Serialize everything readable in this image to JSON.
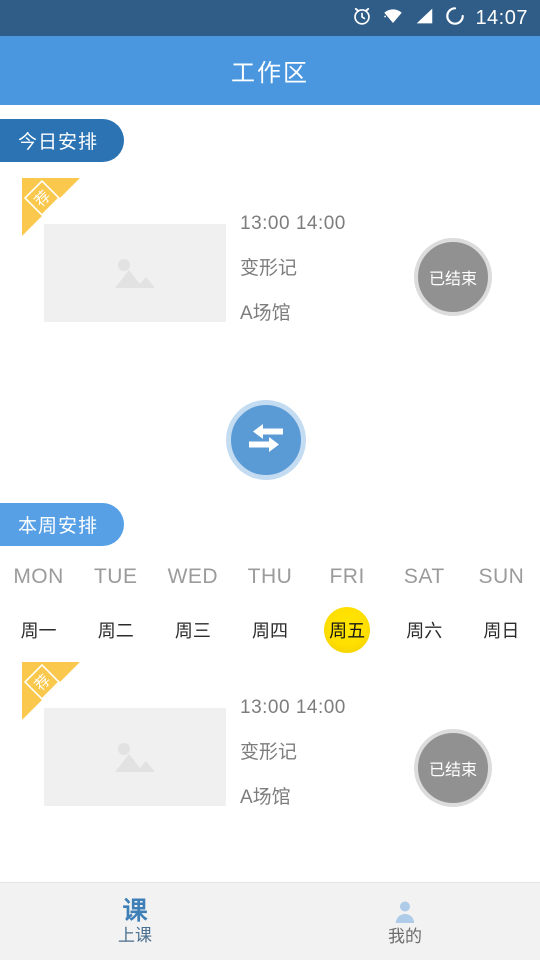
{
  "status_bar": {
    "time": "14:07",
    "icons": [
      "alarm-icon",
      "wifi-icon",
      "signal-icon",
      "sync-icon"
    ]
  },
  "app_bar": {
    "title": "工作区",
    "background": "#4a97e0"
  },
  "sections": {
    "today": {
      "label": "今日安排",
      "pill_color": "#2b73b3"
    },
    "week": {
      "label": "本周安排",
      "pill_color": "#57a0e6"
    }
  },
  "swap_button": {
    "name": "swap-arrows-icon",
    "color": "#5b9bd5"
  },
  "today_event": {
    "ribbon_text": "荐",
    "time": "13:00 14:00",
    "title": "变形记",
    "venue": "A场馆",
    "status": "已结束",
    "status_color": "#919191",
    "thumbnail": "image-placeholder"
  },
  "week_event": {
    "ribbon_text": "荐",
    "time": "13:00 14:00",
    "title": "变形记",
    "venue": "A场馆",
    "status": "已结束",
    "status_color": "#919191",
    "thumbnail": "image-placeholder"
  },
  "week_selector": {
    "selected_index": 4,
    "highlight_color": "#ffdf00",
    "days": [
      {
        "en": "MON",
        "cn": "周一"
      },
      {
        "en": "TUE",
        "cn": "周二"
      },
      {
        "en": "WED",
        "cn": "周三"
      },
      {
        "en": "THU",
        "cn": "周四"
      },
      {
        "en": "FRI",
        "cn": "周五"
      },
      {
        "en": "SAT",
        "cn": "周六"
      },
      {
        "en": "SUN",
        "cn": "周日"
      }
    ]
  },
  "bottom_nav": {
    "items": [
      {
        "glyph": "课",
        "label": "上课",
        "active": true
      },
      {
        "glyph": "person-icon",
        "label": "我的",
        "active": false
      }
    ]
  }
}
